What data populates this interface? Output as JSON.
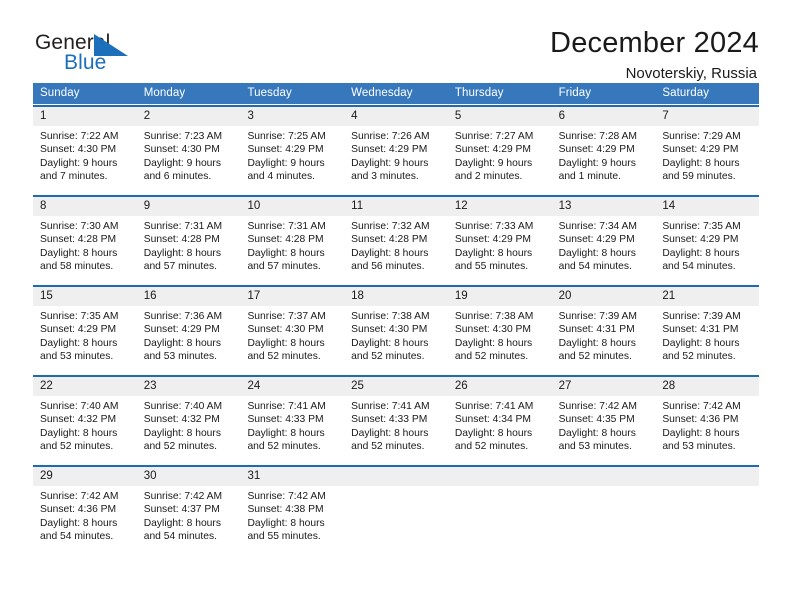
{
  "brand": {
    "name_part1": "General",
    "name_part2": "Blue",
    "accent_color": "#1c6fba"
  },
  "header": {
    "title": "December 2024",
    "subtitle": "Novoterskiy, Russia"
  },
  "theme": {
    "header_bg": "#3778bc",
    "cell_top_border": "#1f6bb0",
    "date_band": "#efefef"
  },
  "weekdays": [
    "Sunday",
    "Monday",
    "Tuesday",
    "Wednesday",
    "Thursday",
    "Friday",
    "Saturday"
  ],
  "weeks": [
    [
      {
        "day": "1",
        "sunrise": "Sunrise: 7:22 AM",
        "sunset": "Sunset: 4:30 PM",
        "daylight1": "Daylight: 9 hours",
        "daylight2": "and 7 minutes."
      },
      {
        "day": "2",
        "sunrise": "Sunrise: 7:23 AM",
        "sunset": "Sunset: 4:30 PM",
        "daylight1": "Daylight: 9 hours",
        "daylight2": "and 6 minutes."
      },
      {
        "day": "3",
        "sunrise": "Sunrise: 7:25 AM",
        "sunset": "Sunset: 4:29 PM",
        "daylight1": "Daylight: 9 hours",
        "daylight2": "and 4 minutes."
      },
      {
        "day": "4",
        "sunrise": "Sunrise: 7:26 AM",
        "sunset": "Sunset: 4:29 PM",
        "daylight1": "Daylight: 9 hours",
        "daylight2": "and 3 minutes."
      },
      {
        "day": "5",
        "sunrise": "Sunrise: 7:27 AM",
        "sunset": "Sunset: 4:29 PM",
        "daylight1": "Daylight: 9 hours",
        "daylight2": "and 2 minutes."
      },
      {
        "day": "6",
        "sunrise": "Sunrise: 7:28 AM",
        "sunset": "Sunset: 4:29 PM",
        "daylight1": "Daylight: 9 hours",
        "daylight2": "and 1 minute."
      },
      {
        "day": "7",
        "sunrise": "Sunrise: 7:29 AM",
        "sunset": "Sunset: 4:29 PM",
        "daylight1": "Daylight: 8 hours",
        "daylight2": "and 59 minutes."
      }
    ],
    [
      {
        "day": "8",
        "sunrise": "Sunrise: 7:30 AM",
        "sunset": "Sunset: 4:28 PM",
        "daylight1": "Daylight: 8 hours",
        "daylight2": "and 58 minutes."
      },
      {
        "day": "9",
        "sunrise": "Sunrise: 7:31 AM",
        "sunset": "Sunset: 4:28 PM",
        "daylight1": "Daylight: 8 hours",
        "daylight2": "and 57 minutes."
      },
      {
        "day": "10",
        "sunrise": "Sunrise: 7:31 AM",
        "sunset": "Sunset: 4:28 PM",
        "daylight1": "Daylight: 8 hours",
        "daylight2": "and 57 minutes."
      },
      {
        "day": "11",
        "sunrise": "Sunrise: 7:32 AM",
        "sunset": "Sunset: 4:28 PM",
        "daylight1": "Daylight: 8 hours",
        "daylight2": "and 56 minutes."
      },
      {
        "day": "12",
        "sunrise": "Sunrise: 7:33 AM",
        "sunset": "Sunset: 4:29 PM",
        "daylight1": "Daylight: 8 hours",
        "daylight2": "and 55 minutes."
      },
      {
        "day": "13",
        "sunrise": "Sunrise: 7:34 AM",
        "sunset": "Sunset: 4:29 PM",
        "daylight1": "Daylight: 8 hours",
        "daylight2": "and 54 minutes."
      },
      {
        "day": "14",
        "sunrise": "Sunrise: 7:35 AM",
        "sunset": "Sunset: 4:29 PM",
        "daylight1": "Daylight: 8 hours",
        "daylight2": "and 54 minutes."
      }
    ],
    [
      {
        "day": "15",
        "sunrise": "Sunrise: 7:35 AM",
        "sunset": "Sunset: 4:29 PM",
        "daylight1": "Daylight: 8 hours",
        "daylight2": "and 53 minutes."
      },
      {
        "day": "16",
        "sunrise": "Sunrise: 7:36 AM",
        "sunset": "Sunset: 4:29 PM",
        "daylight1": "Daylight: 8 hours",
        "daylight2": "and 53 minutes."
      },
      {
        "day": "17",
        "sunrise": "Sunrise: 7:37 AM",
        "sunset": "Sunset: 4:30 PM",
        "daylight1": "Daylight: 8 hours",
        "daylight2": "and 52 minutes."
      },
      {
        "day": "18",
        "sunrise": "Sunrise: 7:38 AM",
        "sunset": "Sunset: 4:30 PM",
        "daylight1": "Daylight: 8 hours",
        "daylight2": "and 52 minutes."
      },
      {
        "day": "19",
        "sunrise": "Sunrise: 7:38 AM",
        "sunset": "Sunset: 4:30 PM",
        "daylight1": "Daylight: 8 hours",
        "daylight2": "and 52 minutes."
      },
      {
        "day": "20",
        "sunrise": "Sunrise: 7:39 AM",
        "sunset": "Sunset: 4:31 PM",
        "daylight1": "Daylight: 8 hours",
        "daylight2": "and 52 minutes."
      },
      {
        "day": "21",
        "sunrise": "Sunrise: 7:39 AM",
        "sunset": "Sunset: 4:31 PM",
        "daylight1": "Daylight: 8 hours",
        "daylight2": "and 52 minutes."
      }
    ],
    [
      {
        "day": "22",
        "sunrise": "Sunrise: 7:40 AM",
        "sunset": "Sunset: 4:32 PM",
        "daylight1": "Daylight: 8 hours",
        "daylight2": "and 52 minutes."
      },
      {
        "day": "23",
        "sunrise": "Sunrise: 7:40 AM",
        "sunset": "Sunset: 4:32 PM",
        "daylight1": "Daylight: 8 hours",
        "daylight2": "and 52 minutes."
      },
      {
        "day": "24",
        "sunrise": "Sunrise: 7:41 AM",
        "sunset": "Sunset: 4:33 PM",
        "daylight1": "Daylight: 8 hours",
        "daylight2": "and 52 minutes."
      },
      {
        "day": "25",
        "sunrise": "Sunrise: 7:41 AM",
        "sunset": "Sunset: 4:33 PM",
        "daylight1": "Daylight: 8 hours",
        "daylight2": "and 52 minutes."
      },
      {
        "day": "26",
        "sunrise": "Sunrise: 7:41 AM",
        "sunset": "Sunset: 4:34 PM",
        "daylight1": "Daylight: 8 hours",
        "daylight2": "and 52 minutes."
      },
      {
        "day": "27",
        "sunrise": "Sunrise: 7:42 AM",
        "sunset": "Sunset: 4:35 PM",
        "daylight1": "Daylight: 8 hours",
        "daylight2": "and 53 minutes."
      },
      {
        "day": "28",
        "sunrise": "Sunrise: 7:42 AM",
        "sunset": "Sunset: 4:36 PM",
        "daylight1": "Daylight: 8 hours",
        "daylight2": "and 53 minutes."
      }
    ],
    [
      {
        "day": "29",
        "sunrise": "Sunrise: 7:42 AM",
        "sunset": "Sunset: 4:36 PM",
        "daylight1": "Daylight: 8 hours",
        "daylight2": "and 54 minutes."
      },
      {
        "day": "30",
        "sunrise": "Sunrise: 7:42 AM",
        "sunset": "Sunset: 4:37 PM",
        "daylight1": "Daylight: 8 hours",
        "daylight2": "and 54 minutes."
      },
      {
        "day": "31",
        "sunrise": "Sunrise: 7:42 AM",
        "sunset": "Sunset: 4:38 PM",
        "daylight1": "Daylight: 8 hours",
        "daylight2": "and 55 minutes."
      },
      {
        "day": "",
        "sunrise": "",
        "sunset": "",
        "daylight1": "",
        "daylight2": ""
      },
      {
        "day": "",
        "sunrise": "",
        "sunset": "",
        "daylight1": "",
        "daylight2": ""
      },
      {
        "day": "",
        "sunrise": "",
        "sunset": "",
        "daylight1": "",
        "daylight2": ""
      },
      {
        "day": "",
        "sunrise": "",
        "sunset": "",
        "daylight1": "",
        "daylight2": ""
      }
    ]
  ]
}
